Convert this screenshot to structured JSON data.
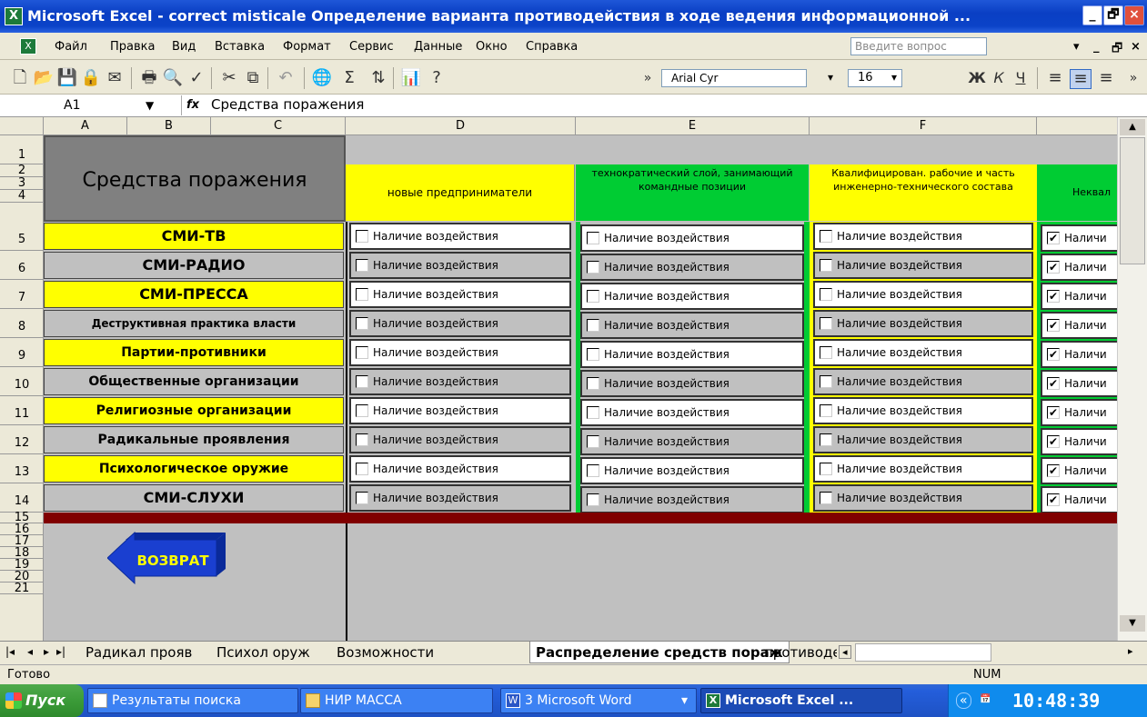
{
  "window": {
    "title": "Microsoft Excel - correct misticale Определение варианта противодействия в ходе ведения информационной ...",
    "buttons": [
      "_",
      "🗗",
      "×"
    ]
  },
  "menu": {
    "items": [
      "Файл",
      "Правка",
      "Вид",
      "Вставка",
      "Формат",
      "Сервис",
      "Данные",
      "Окно",
      "Справка"
    ],
    "ask_placeholder": "Введите вопрос",
    "doc_buttons": [
      "▾",
      "_",
      "🗗",
      "×"
    ]
  },
  "toolbar": {
    "font": "Arial Cyr",
    "size": "16",
    "bold": "Ж",
    "italic": "К",
    "underline": "Ч"
  },
  "formula": {
    "cell": "A1",
    "fx": "fx",
    "value": "Средства поражения"
  },
  "columns": [
    "A",
    "B",
    "C",
    "D",
    "E",
    "F"
  ],
  "rows": [
    "1",
    "2",
    "3",
    "4",
    "5",
    "6",
    "7",
    "8",
    "9",
    "10",
    "11",
    "12",
    "13",
    "14",
    "15",
    "16",
    "17",
    "18",
    "19",
    "20",
    "21"
  ],
  "header": {
    "main": "Средства поражения",
    "d": "новые предприниматели",
    "e": "технократический слой, занимающий командные позиции",
    "f": "Квалифицирован. рабочие и часть инженерно-технического состава",
    "g": "Неквал"
  },
  "items": [
    "СМИ-ТВ",
    "СМИ-РАДИО",
    "СМИ-ПРЕССА",
    "Деструктивная практика власти",
    "Партии-противники",
    "Общественные организации",
    "Религиозные организации",
    "Радикальные проявления",
    "Психологическое оружие",
    "СМИ-СЛУХИ"
  ],
  "checkbox_label": "Наличие воздействия",
  "checkbox_label_cut": "Наличи",
  "checked_mark": "✔",
  "back_button": "ВОЗВРАТ",
  "sheets": [
    "Радикал прояв",
    "Психол оруж",
    "Возможности",
    "Распределение средств пораж",
    "противодей"
  ],
  "status": {
    "left": "Готово",
    "right": "NUM"
  },
  "taskbar": {
    "start": "Пуск",
    "tasks": [
      "Результаты поиска",
      "НИР МАССА",
      "3 Microsoft Word",
      "Microsoft Excel ..."
    ],
    "clock": "10:48:39"
  },
  "colors": {
    "yellow": "#ffff00",
    "green": "#00cc33",
    "gray": "#c0c0c0",
    "maroon": "#800000",
    "blue": "#1a3fd0"
  }
}
